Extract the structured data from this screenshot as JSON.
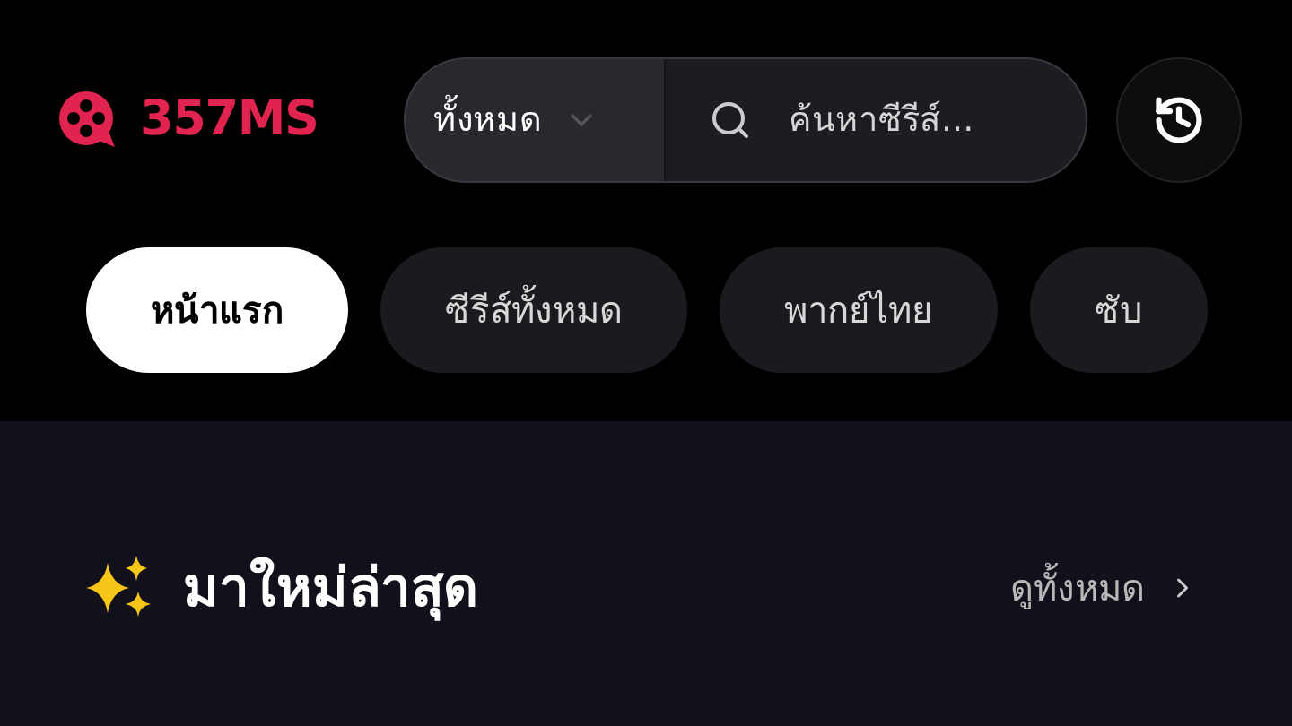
{
  "logo": {
    "text": "357MS"
  },
  "search": {
    "category": "ทั้งหมด",
    "placeholder": "ค้นหาซีรีส์..."
  },
  "tabs": [
    {
      "label": "หน้าแรก",
      "selected": true
    },
    {
      "label": "ซีรีส์ทั้งหมด",
      "selected": false
    },
    {
      "label": "พากย์ไทย",
      "selected": false
    },
    {
      "label": "ซับ",
      "selected": false
    }
  ],
  "section": {
    "title": "มาใหม่ล่าสุด",
    "see_all": "ดูทั้งหมด"
  }
}
